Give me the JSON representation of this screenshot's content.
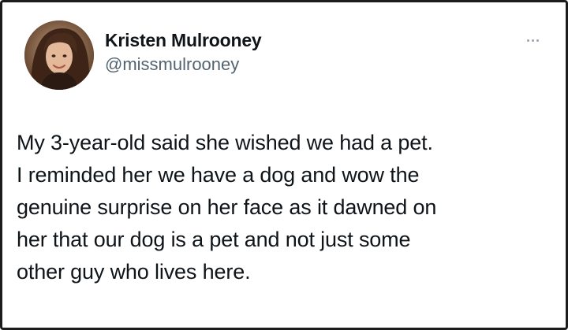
{
  "author": {
    "display_name": "Kristen Mulrooney",
    "handle": "@missmulrooney"
  },
  "tweet": {
    "lines": [
      "My 3-year-old said she wished we had a pet.",
      "I reminded her we have a dog and wow the",
      "genuine surprise on her face as it dawned on",
      "her that our dog is a pet and not just some",
      "other guy who lives here."
    ]
  },
  "icons": {
    "more": "more-horizontal-icon"
  }
}
